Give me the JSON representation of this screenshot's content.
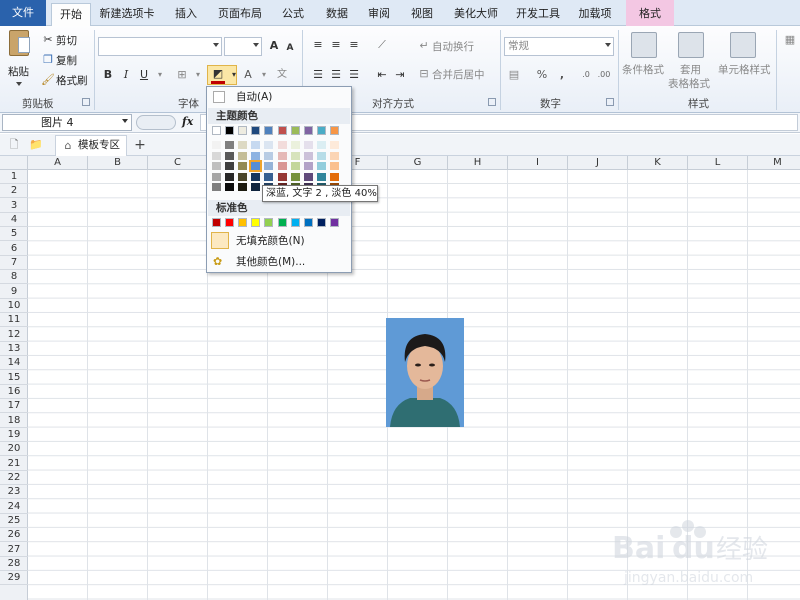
{
  "tabs": [
    {
      "label": "文件"
    },
    {
      "label": "开始"
    },
    {
      "label": "新建选项卡"
    },
    {
      "label": "插入"
    },
    {
      "label": "页面布局"
    },
    {
      "label": "公式"
    },
    {
      "label": "数据"
    },
    {
      "label": "审阅"
    },
    {
      "label": "视图"
    },
    {
      "label": "美化大师"
    },
    {
      "label": "开发工具"
    },
    {
      "label": "加载项"
    },
    {
      "label": "格式"
    }
  ],
  "ribbon": {
    "clipboard": {
      "paste": "粘贴",
      "cut": "剪切",
      "copy": "复制",
      "painter": "格式刷",
      "group": "剪贴板"
    },
    "font": {
      "group": "字体",
      "bold": "B",
      "italic": "I",
      "underline": "U",
      "grow": "A",
      "shrink": "A",
      "font_color": "A"
    },
    "alignment": {
      "wrap": "自动换行",
      "merge": "合并后居中",
      "group": "对齐方式"
    },
    "number": {
      "format": "常规",
      "percent": "%",
      "comma": ",",
      "group": "数字"
    },
    "styles": {
      "conditional": "条件格式",
      "table_line1": "套用",
      "table_line2": "表格格式",
      "cell": "单元格样式",
      "group": "样式"
    }
  },
  "formula_bar": {
    "name_box": "图片 4",
    "fx": "fx"
  },
  "workbook_tabs": {
    "template": "模板专区",
    "add": "+"
  },
  "columns": [
    "A",
    "B",
    "C",
    "D",
    "E",
    "F",
    "G",
    "H",
    "I",
    "J",
    "K",
    "L",
    "M"
  ],
  "rows": [
    "1",
    "2",
    "3",
    "4",
    "5",
    "6",
    "7",
    "8",
    "9",
    "10",
    "11",
    "12",
    "13",
    "14",
    "15",
    "16",
    "17",
    "18",
    "19",
    "20",
    "21",
    "22",
    "23",
    "24",
    "25",
    "26",
    "27",
    "28",
    "29"
  ],
  "color_menu": {
    "auto": "自动(A)",
    "theme_header": "主题颜色",
    "standard_header": "标准色",
    "no_fill": "无填充颜色(N)",
    "more": "其他颜色(M)...",
    "tooltip": "深蓝, 文字 2 , 淡色 40%",
    "theme_top": [
      "#ffffff",
      "#000000",
      "#eeece1",
      "#1f497d",
      "#4f81bd",
      "#c0504d",
      "#9bbb59",
      "#8064a2",
      "#4bacc6",
      "#f79646"
    ],
    "theme_shades": [
      [
        "#f2f2f2",
        "#d8d8d8",
        "#bfbfbf",
        "#a5a5a5",
        "#7f7f7f"
      ],
      [
        "#7f7f7f",
        "#595959",
        "#3f3f3f",
        "#262626",
        "#0c0c0c"
      ],
      [
        "#ddd9c3",
        "#c4bd97",
        "#938953",
        "#494429",
        "#1d1b10"
      ],
      [
        "#c6d9f0",
        "#8db3e2",
        "#548dd4",
        "#17365d",
        "#0f243e"
      ],
      [
        "#dbe5f1",
        "#b8cce4",
        "#95b3d7",
        "#366092",
        "#244061"
      ],
      [
        "#f2dcdb",
        "#e5b9b7",
        "#d99694",
        "#953734",
        "#632423"
      ],
      [
        "#ebf1dd",
        "#d7e3bc",
        "#c3d69b",
        "#76923c",
        "#4f6128"
      ],
      [
        "#e5e0ec",
        "#ccc1d9",
        "#b2a2c7",
        "#5f497a",
        "#3f3151"
      ],
      [
        "#dbeef3",
        "#b7dde8",
        "#92cddc",
        "#31859b",
        "#205867"
      ],
      [
        "#fdeada",
        "#fbd5b5",
        "#fac08f",
        "#e36c09",
        "#974806"
      ]
    ],
    "standard": [
      "#c00000",
      "#ff0000",
      "#ffc000",
      "#ffff00",
      "#92d050",
      "#00b050",
      "#00b0f0",
      "#0070c0",
      "#002060",
      "#7030a0"
    ]
  }
}
